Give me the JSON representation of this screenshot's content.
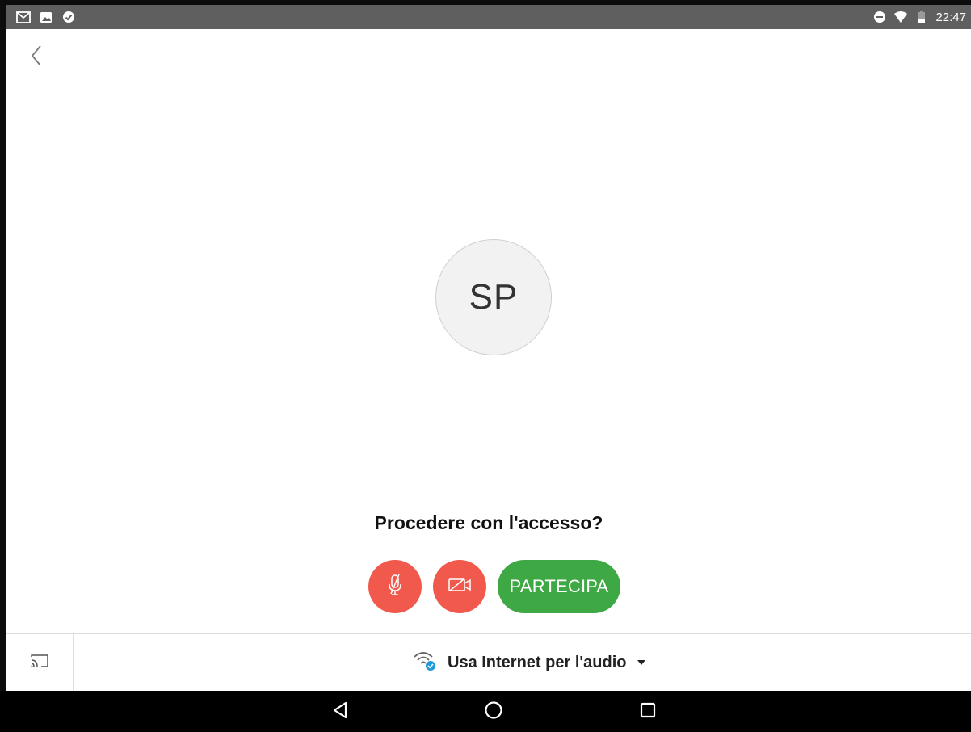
{
  "status_bar": {
    "left_icons": [
      "gmail-icon",
      "image-icon",
      "sync-icon"
    ],
    "right_icons": [
      "do-not-disturb-icon",
      "wifi-icon",
      "battery-icon"
    ],
    "time": "22:47"
  },
  "header": {
    "back_icon": "chevron-left-icon"
  },
  "avatar": {
    "initials": "SP"
  },
  "prompt": {
    "text": "Procedere con l'accesso?"
  },
  "controls": {
    "mute_icon": "mic-off-icon",
    "video_icon": "video-off-icon",
    "join_label": "PARTECIPA",
    "colors": {
      "mute": "#f0594c",
      "video": "#f0594c",
      "join": "#3ea844"
    }
  },
  "bottom_bar": {
    "cast_icon": "cast-icon",
    "audio_icon": "internet-audio-icon",
    "audio_label": "Usa Internet per l'audio",
    "dropdown_icon": "caret-down-icon"
  },
  "nav_bar": {
    "icons": [
      "nav-back-icon",
      "nav-home-icon",
      "nav-recents-icon"
    ]
  }
}
